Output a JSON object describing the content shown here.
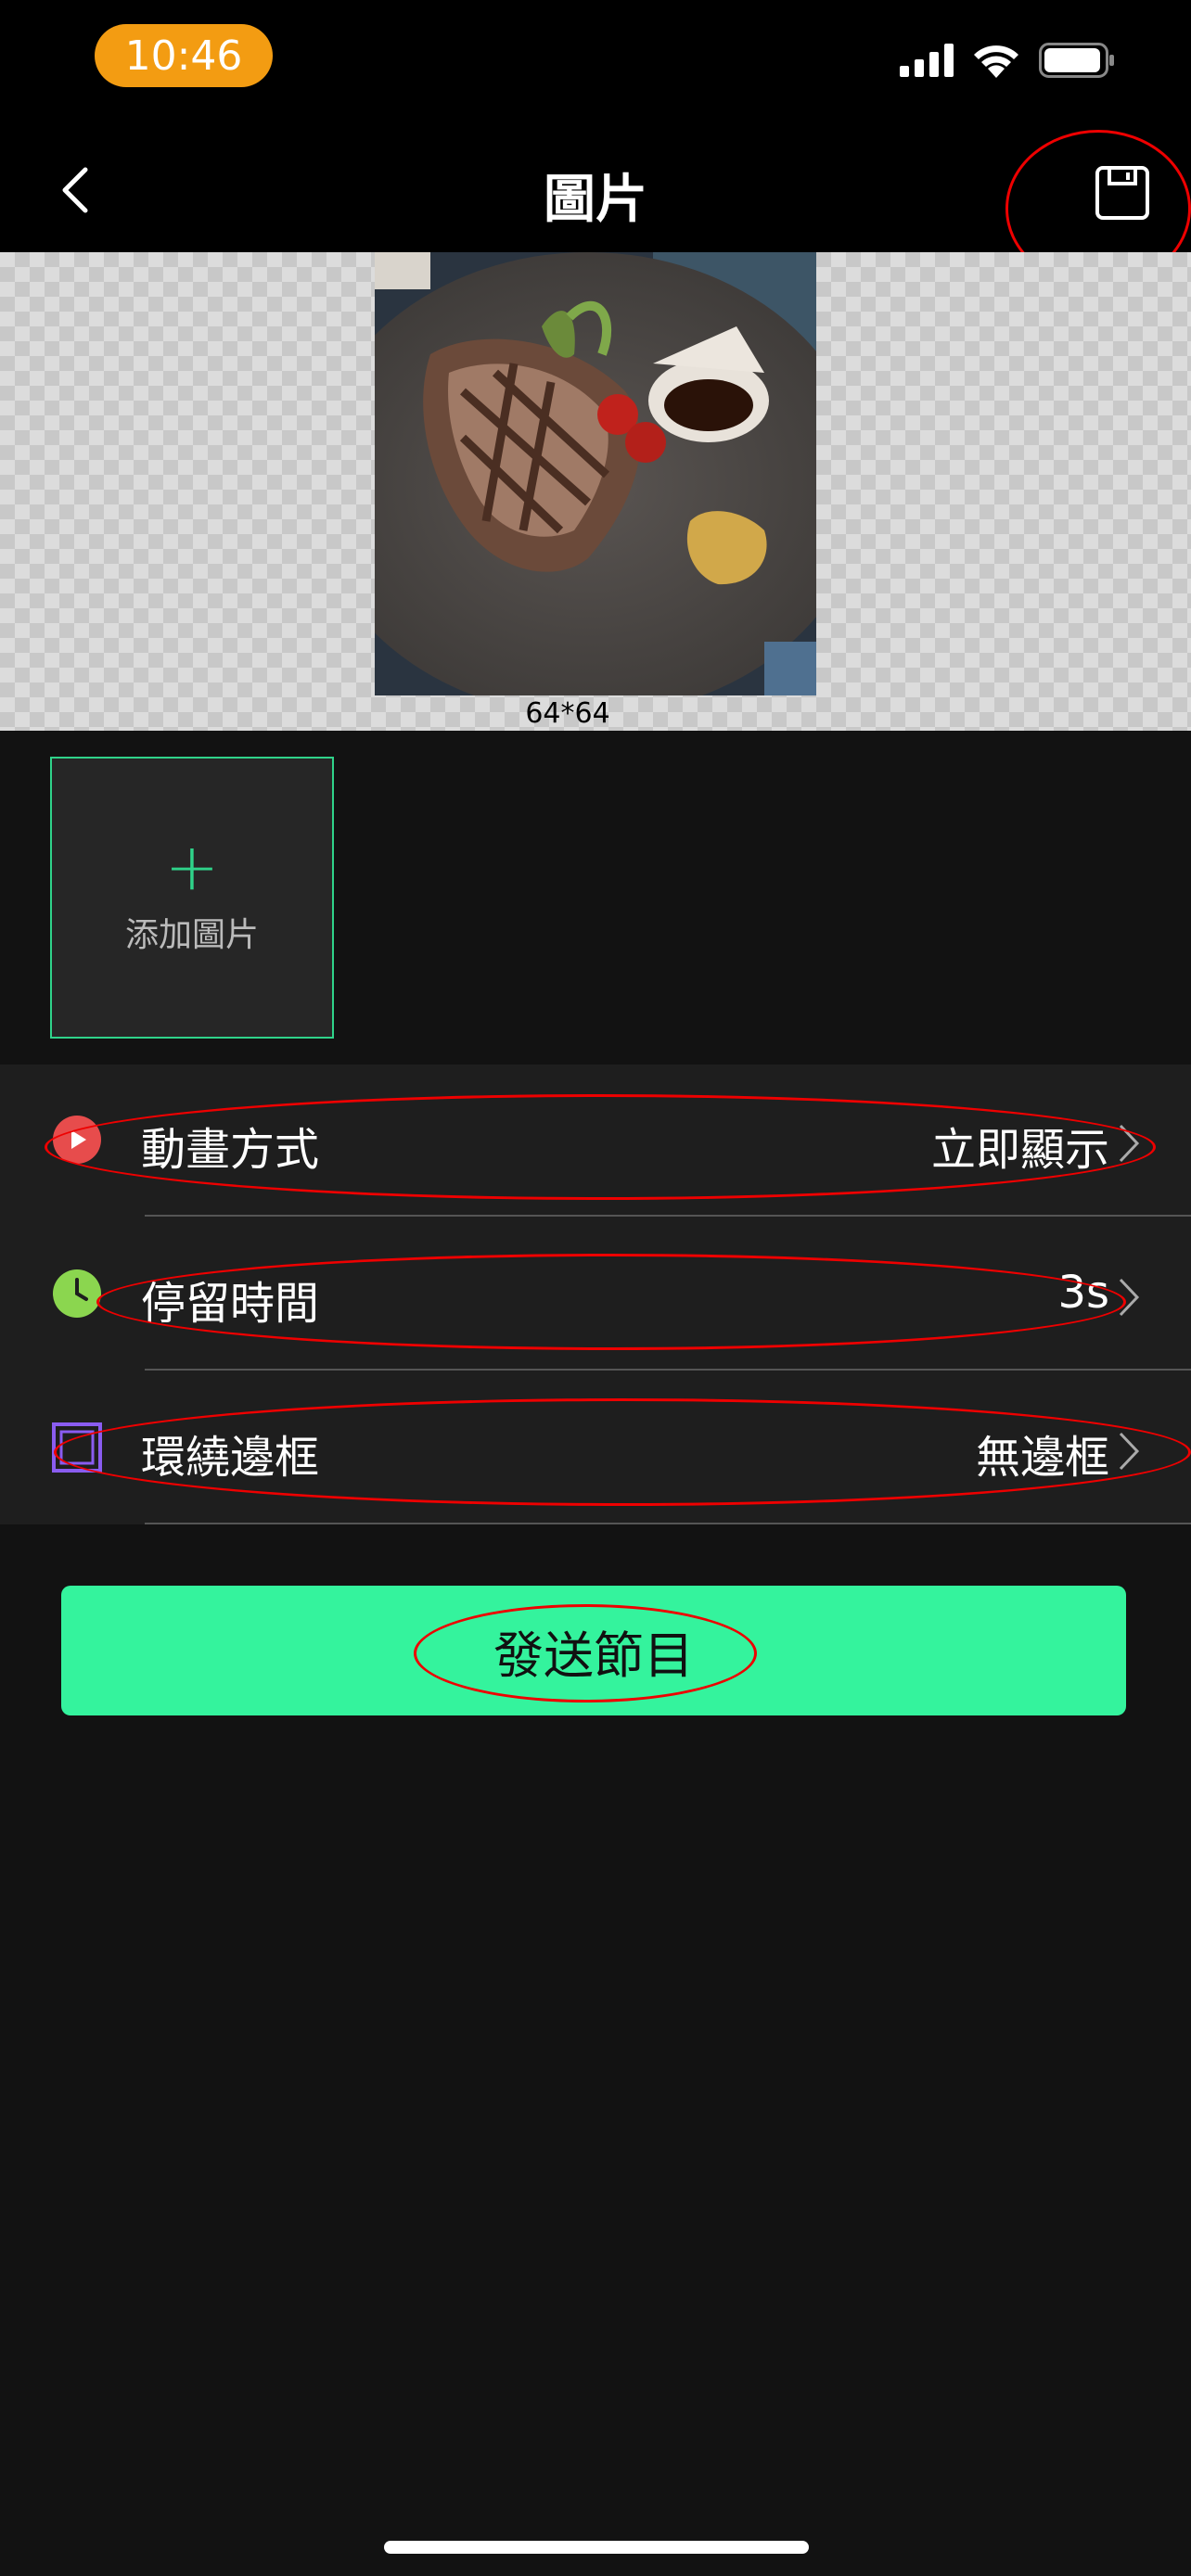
{
  "status_bar": {
    "time": "10:46"
  },
  "nav": {
    "title": "圖片"
  },
  "preview": {
    "size_text": "64*64"
  },
  "gallery": {
    "add_label": "添加圖片",
    "add_symbol": "+"
  },
  "settings": [
    {
      "label": "動畫方式",
      "value": "立即顯示",
      "icon": "play-icon",
      "icon_color": "#e74c4c"
    },
    {
      "label": "停留時間",
      "value": "3s",
      "icon": "clock-icon",
      "icon_color": "#8bd64f"
    },
    {
      "label": "環繞邊框",
      "value": "無邊框",
      "icon": "border-frame-icon",
      "icon_color": "#8a5cf0"
    }
  ],
  "send_button": {
    "label": "發送節目"
  },
  "colors": {
    "accent": "#34f39d",
    "time_pill": "#f39c12",
    "annotation": "#ee0000"
  }
}
